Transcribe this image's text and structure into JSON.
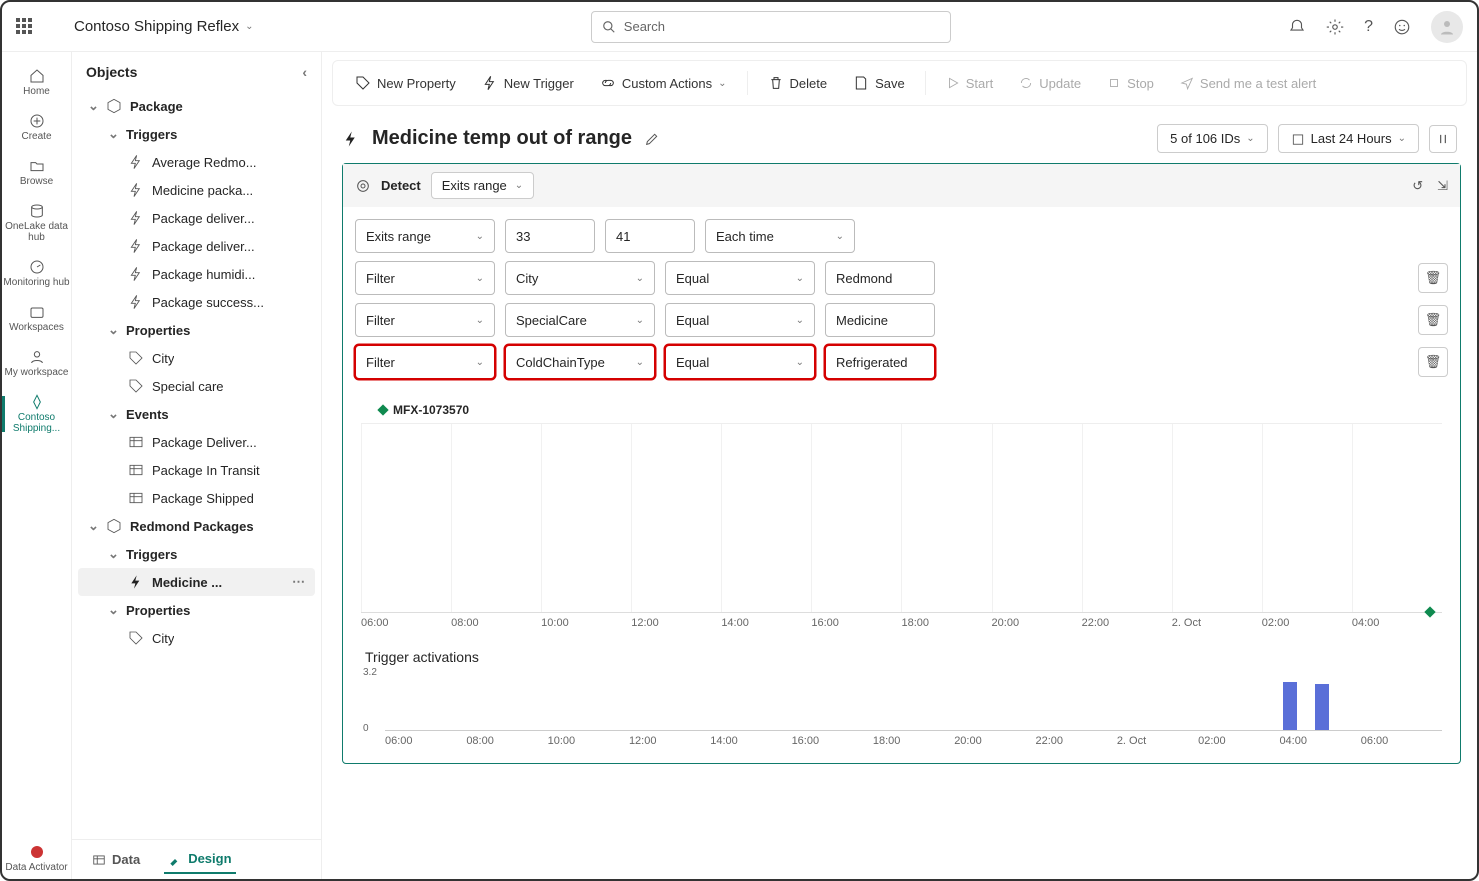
{
  "workspace": "Contoso Shipping Reflex",
  "search_placeholder": "Search",
  "rail": [
    "Home",
    "Create",
    "Browse",
    "OneLake data hub",
    "Monitoring hub",
    "Workspaces",
    "My workspace",
    "Contoso Shipping...",
    "Data Activator"
  ],
  "side_title": "Objects",
  "tree": {
    "package": "Package",
    "triggers": "Triggers",
    "t_items": [
      "Average Redmo...",
      "Medicine packa...",
      "Package deliver...",
      "Package deliver...",
      "Package humidi...",
      "Package success..."
    ],
    "properties": "Properties",
    "p_items": [
      "City",
      "Special care"
    ],
    "events": "Events",
    "e_items": [
      "Package Deliver...",
      "Package In Transit",
      "Package Shipped"
    ],
    "redmond": "Redmond Packages",
    "r_trig": "Triggers",
    "r_sel": "Medicine ...",
    "r_props": "Properties",
    "r_city": "City"
  },
  "toolbar": {
    "new_prop": "New Property",
    "new_trig": "New Trigger",
    "custom": "Custom Actions",
    "delete": "Delete",
    "save": "Save",
    "start": "Start",
    "update": "Update",
    "stop": "Stop",
    "send": "Send me a test alert"
  },
  "page": {
    "title": "Medicine temp out of range",
    "ids": "5 of 106 IDs",
    "time": "Last 24 Hours"
  },
  "detect": {
    "label": "Detect",
    "mode": "Exits range",
    "row0": {
      "op": "Exits range",
      "v1": "33",
      "v2": "41",
      "freq": "Each time"
    },
    "rows": [
      {
        "type": "Filter",
        "field": "City",
        "cmp": "Equal",
        "val": "Redmond"
      },
      {
        "type": "Filter",
        "field": "SpecialCare",
        "cmp": "Equal",
        "val": "Medicine"
      },
      {
        "type": "Filter",
        "field": "ColdChainType",
        "cmp": "Equal",
        "val": "Refrigerated"
      }
    ]
  },
  "series": "MFX-1073570",
  "xticks": [
    "06:00",
    "08:00",
    "10:00",
    "12:00",
    "14:00",
    "16:00",
    "18:00",
    "20:00",
    "22:00",
    "2. Oct",
    "02:00",
    "04:00"
  ],
  "trig_title": "Trigger activations",
  "ytick": "3.2",
  "ytick0": "0",
  "xticks2": [
    "06:00",
    "08:00",
    "10:00",
    "12:00",
    "14:00",
    "16:00",
    "18:00",
    "20:00",
    "22:00",
    "2. Oct",
    "02:00",
    "04:00",
    "06:00"
  ],
  "tabs": {
    "data": "Data",
    "design": "Design"
  },
  "chart_data": {
    "type": "bar",
    "title": "Trigger activations",
    "categories": [
      "06:00",
      "08:00",
      "10:00",
      "12:00",
      "14:00",
      "16:00",
      "18:00",
      "20:00",
      "22:00",
      "2. Oct",
      "02:00",
      "04:00",
      "06:00"
    ],
    "values": [
      0,
      0,
      0,
      0,
      0,
      0,
      0,
      0,
      0,
      0,
      0,
      3.2,
      3.0
    ],
    "ylim": [
      0,
      3.2
    ]
  }
}
